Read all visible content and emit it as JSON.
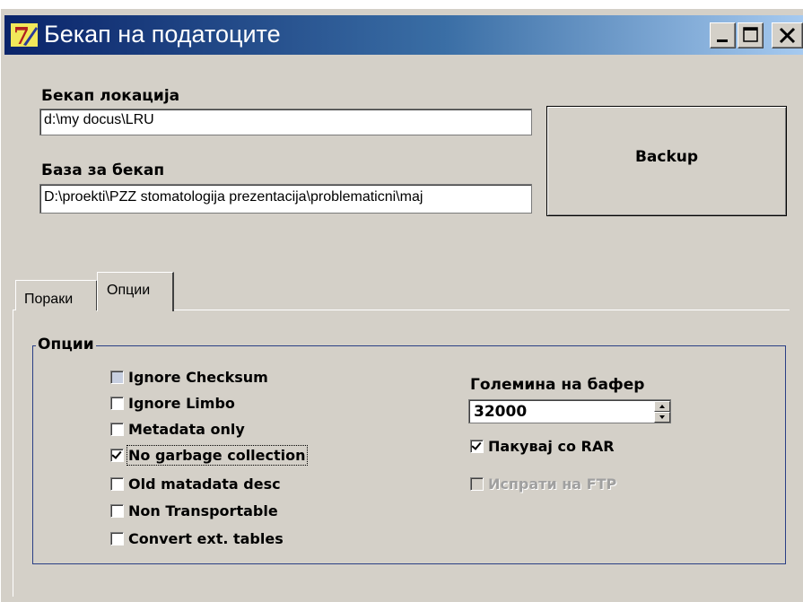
{
  "window": {
    "title": "Бекап на податоците",
    "icon": "delphi-app-icon",
    "controls": [
      "minimize-icon",
      "maximize-icon",
      "close-icon"
    ]
  },
  "backup_location": {
    "label": "Бекап локација",
    "value": "d:\\my docus\\LRU"
  },
  "database": {
    "label": "База за бекап",
    "value": "D:\\proekti\\PZZ stomatologija prezentacija\\problematicni\\maj"
  },
  "backup_button": {
    "label": "Backup"
  },
  "tabs": [
    {
      "label": "Пораки",
      "active": false
    },
    {
      "label": "Опции",
      "active": true
    }
  ],
  "options_group": {
    "title": "Опции",
    "checkboxes": [
      {
        "label": "Ignore Checksum",
        "checked": false
      },
      {
        "label": "Ignore Limbo",
        "checked": false
      },
      {
        "label": "Metadata only",
        "checked": false
      },
      {
        "label": "No garbage collection",
        "checked": true
      },
      {
        "label": "Old matadata desc",
        "checked": false
      },
      {
        "label": "Non Transportable",
        "checked": false
      },
      {
        "label": "Convert ext. tables",
        "checked": false
      }
    ],
    "buffer": {
      "label": "Големина на бафер",
      "value": "32000"
    },
    "pack_rar": {
      "label": "Пакувај со RAR",
      "checked": true
    },
    "send_ftp": {
      "label": "Испрати на FTP",
      "checked": false,
      "enabled": false
    }
  },
  "colors": {
    "titlebar_start": "#0a246a",
    "titlebar_end": "#a6caf0",
    "window_bg": "#d4d0c8",
    "group_border": "#2a3f85"
  }
}
